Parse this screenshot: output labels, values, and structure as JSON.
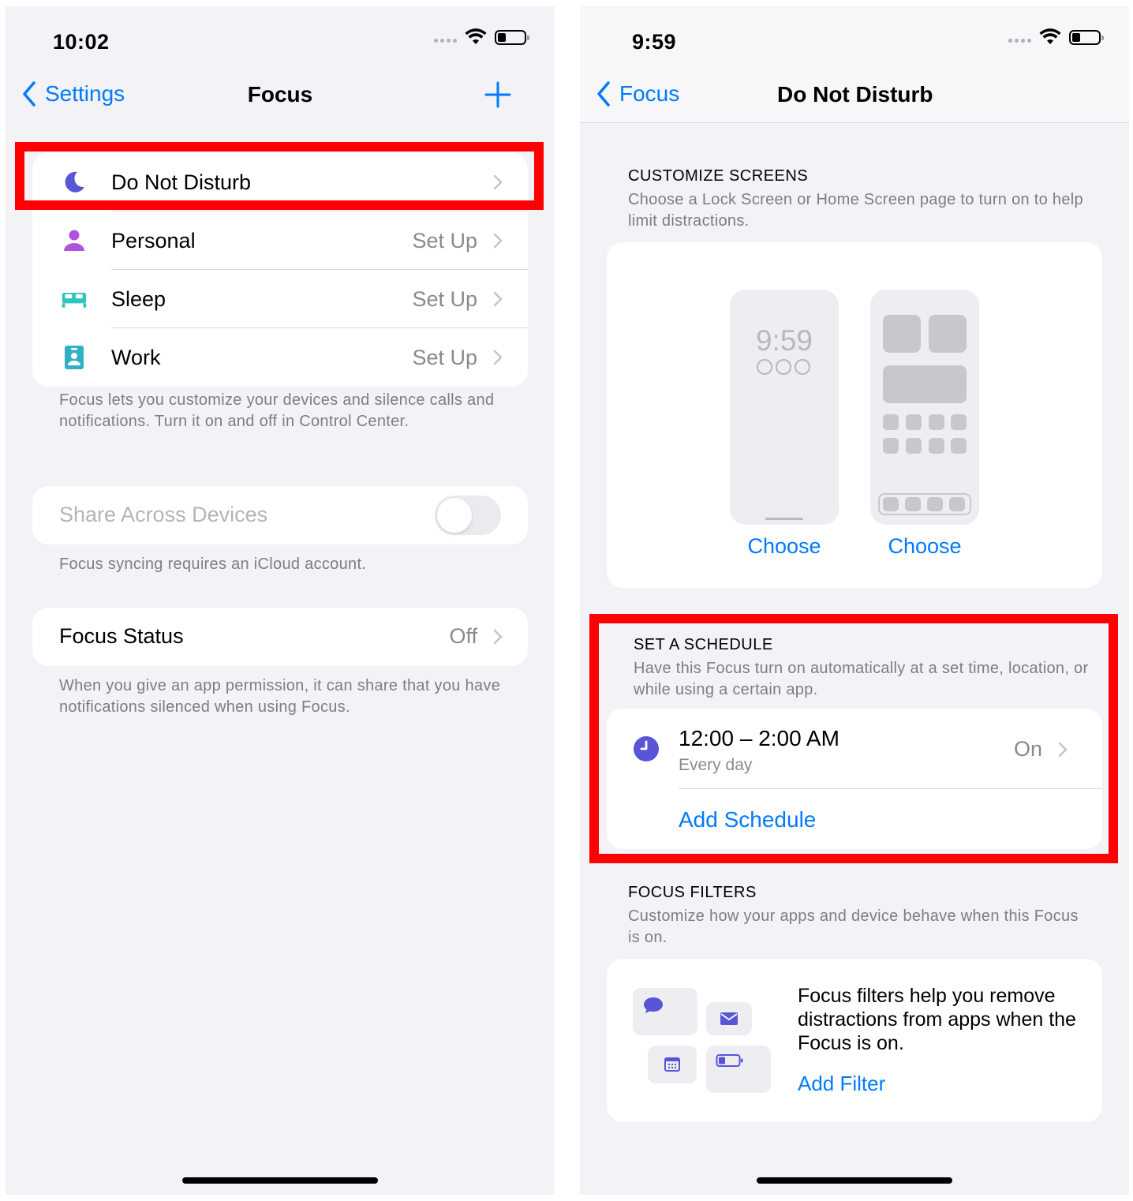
{
  "left": {
    "status": {
      "time": "10:02"
    },
    "nav": {
      "back_label": "Settings",
      "title": "Focus"
    },
    "focus_list": [
      {
        "label": "Do Not Disturb",
        "value": "",
        "icon": "moon-icon"
      },
      {
        "label": "Personal",
        "value": "Set Up",
        "icon": "person-icon"
      },
      {
        "label": "Sleep",
        "value": "Set Up",
        "icon": "bed-icon"
      },
      {
        "label": "Work",
        "value": "Set Up",
        "icon": "id-badge-icon"
      }
    ],
    "focus_footer": "Focus lets you customize your devices and silence calls and notifications. Turn it on and off in Control Center.",
    "share": {
      "label": "Share Across Devices",
      "footer": "Focus syncing requires an iCloud account."
    },
    "focus_status": {
      "label": "Focus Status",
      "value": "Off",
      "footer": "When you give an app permission, it can share that you have notifications silenced when using Focus."
    }
  },
  "right": {
    "status": {
      "time": "9:59"
    },
    "nav": {
      "back_label": "Focus",
      "title": "Do Not Disturb"
    },
    "customize": {
      "title": "CUSTOMIZE SCREENS",
      "subtitle": "Choose a Lock Screen or Home Screen page to turn on to help limit distractions.",
      "lock_time": "9:59",
      "choose_lock": "Choose",
      "choose_home": "Choose"
    },
    "schedule": {
      "title": "SET A SCHEDULE",
      "subtitle": "Have this Focus turn on automatically at a set time, location, or while using a certain app.",
      "time_range": "12:00 – 2:00 AM",
      "repeat": "Every day",
      "state": "On",
      "add_label": "Add Schedule"
    },
    "filters": {
      "title": "FOCUS FILTERS",
      "subtitle": "Customize how your apps and device behave when this Focus is on.",
      "description": "Focus filters help you remove distractions from apps when the Focus is on.",
      "add_label": "Add Filter"
    }
  },
  "colors": {
    "accent": "#007aff",
    "highlight": "#ff0000",
    "indigo": "#5856d6",
    "teal": "#30c5c0",
    "purple": "#af52de"
  }
}
